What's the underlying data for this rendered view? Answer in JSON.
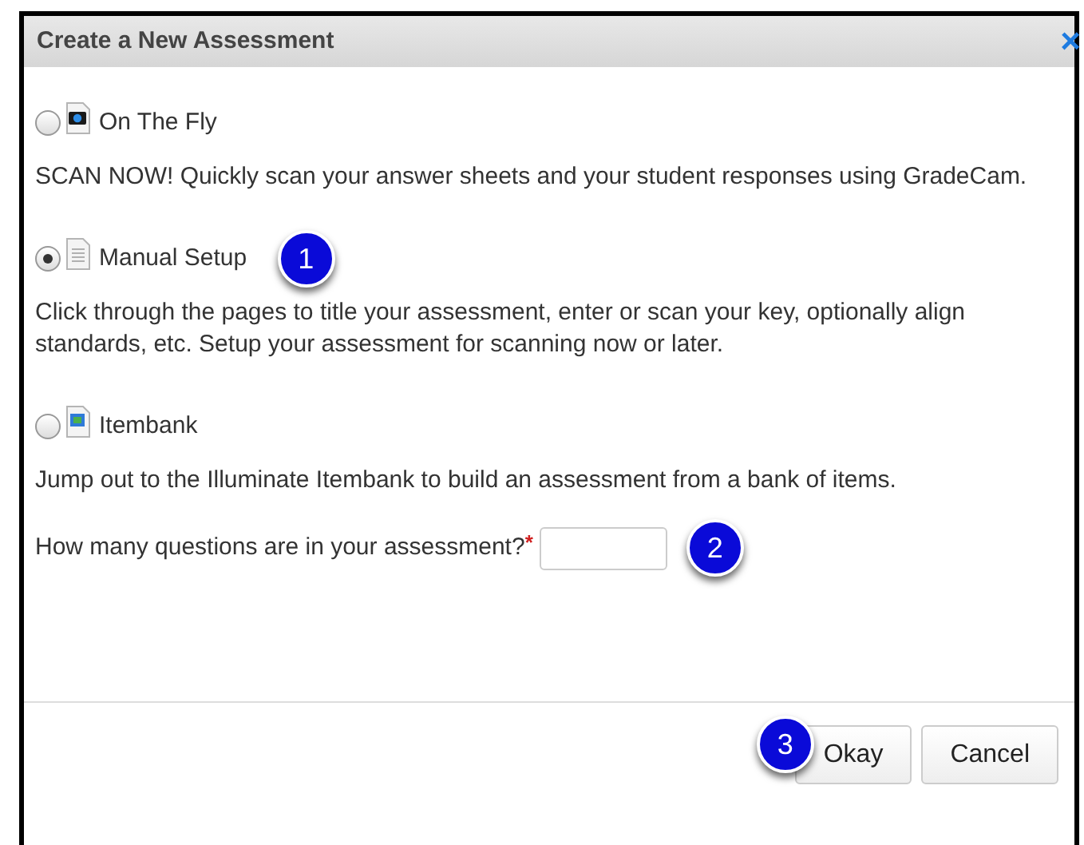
{
  "dialog": {
    "title": "Create a New Assessment",
    "close": "×"
  },
  "options": [
    {
      "label": "On The Fly",
      "kind": "camera",
      "selected": false,
      "description": "SCAN NOW! Quickly scan your answer sheets and your student responses using GradeCam."
    },
    {
      "label": "Manual Setup",
      "kind": "document",
      "selected": true,
      "description": "Click through the pages to title your assessment, enter or scan your key, optionally align standards, etc. Setup your assessment for scanning now or later.",
      "callout": "1"
    },
    {
      "label": "Itembank",
      "kind": "image",
      "selected": false,
      "description": "Jump out to the Illuminate Itembank to build an assessment from a bank of items."
    }
  ],
  "question": {
    "label": "How many questions are in your assessment?",
    "required": "*",
    "callout": "2"
  },
  "buttons": [
    {
      "label": "Okay",
      "callout": "3"
    },
    {
      "label": "Cancel"
    }
  ]
}
